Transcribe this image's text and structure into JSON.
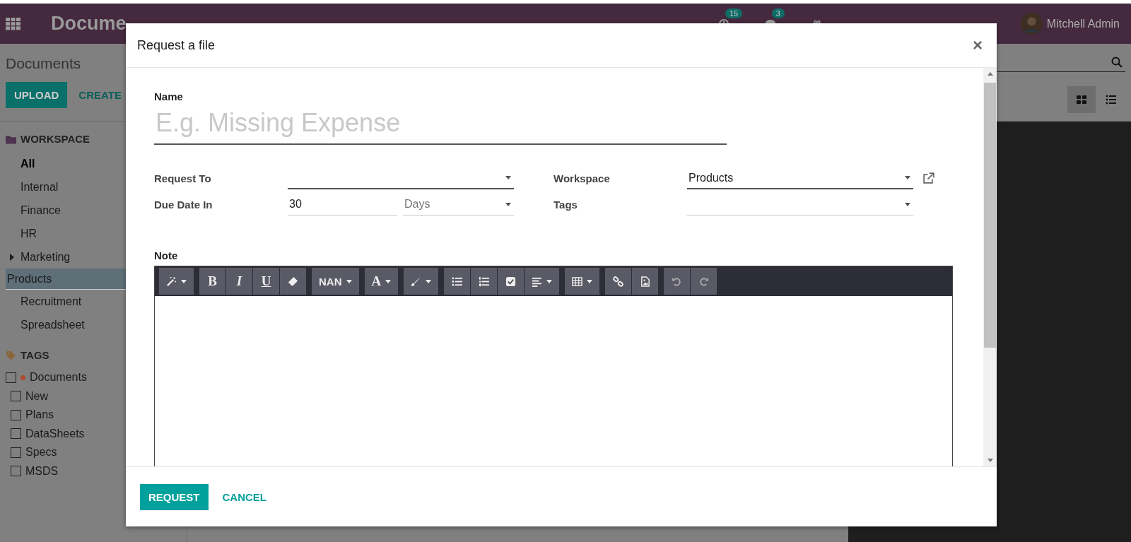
{
  "navbar": {
    "brand": "Docume",
    "systray": [
      {
        "kind": "activity",
        "badge": "15"
      },
      {
        "kind": "chat",
        "badge": "3"
      },
      {
        "kind": "gift"
      }
    ],
    "user": "Mitchell Admin"
  },
  "control_panel": {
    "breadcrumb": "Documents",
    "buttons": [
      "UPLOAD",
      "CREATE"
    ],
    "views": [
      {
        "kind": "kanban",
        "selected": true
      },
      {
        "kind": "list",
        "selected": false
      }
    ]
  },
  "sidebar": {
    "workspace_title": "WORKSPACE",
    "workspaces": [
      {
        "label": "All",
        "active": true,
        "selected": false,
        "expandable": false
      },
      {
        "label": "Internal",
        "active": false,
        "selected": false,
        "expandable": false
      },
      {
        "label": "Finance",
        "active": false,
        "selected": false,
        "expandable": false
      },
      {
        "label": "HR",
        "active": false,
        "selected": false,
        "expandable": false
      },
      {
        "label": "Marketing",
        "active": false,
        "selected": false,
        "expandable": true
      },
      {
        "label": "Products",
        "active": false,
        "selected": true,
        "expandable": false
      },
      {
        "label": "Recruitment",
        "active": false,
        "selected": false,
        "expandable": false
      },
      {
        "label": "Spreadsheet",
        "active": false,
        "selected": false,
        "expandable": false
      }
    ],
    "tags_title": "TAGS",
    "tags": [
      {
        "label": "Documents",
        "checked": false,
        "color": "#b04a30",
        "children": [
          {
            "label": "New",
            "checked": false
          },
          {
            "label": "Plans",
            "checked": false
          },
          {
            "label": "DataSheets",
            "checked": false
          },
          {
            "label": "Specs",
            "checked": false
          },
          {
            "label": "MSDS",
            "checked": false
          }
        ]
      }
    ]
  },
  "dialog": {
    "title": "Request a file",
    "close": "×",
    "name_label": "Name",
    "name_placeholder": "E.g. Missing Expense",
    "fields_left": [
      {
        "label": "Request To",
        "kind": "select",
        "focused": true,
        "link": false
      },
      {
        "label": "Due Date In",
        "kind": "duration",
        "value": "30",
        "unit": "Days",
        "focused": false
      }
    ],
    "fields_right": [
      {
        "label": "Workspace",
        "kind": "select",
        "value": "Products",
        "focused": true,
        "link": true
      },
      {
        "label": "Tags",
        "kind": "select",
        "focused": false,
        "link": false
      }
    ],
    "note_label": "Note",
    "toolbar": [
      [
        {
          "kind": "wand",
          "caret": true
        }
      ],
      [
        {
          "kind": "bold",
          "text": "B"
        },
        {
          "kind": "italic",
          "text": "I"
        },
        {
          "kind": "underline",
          "text": "U"
        },
        {
          "kind": "eraser"
        }
      ],
      [
        {
          "kind": "fontsize",
          "text": "NAN",
          "caret": true
        }
      ],
      [
        {
          "kind": "fontcolor",
          "text": "A",
          "caret": true
        }
      ],
      [
        {
          "kind": "brush",
          "caret": true
        }
      ],
      [
        {
          "kind": "bullets"
        },
        {
          "kind": "numbers"
        },
        {
          "kind": "checkbox"
        },
        {
          "kind": "align",
          "caret": true
        }
      ],
      [
        {
          "kind": "table",
          "caret": true
        }
      ],
      [
        {
          "kind": "link"
        },
        {
          "kind": "image"
        }
      ],
      [
        {
          "kind": "undo"
        },
        {
          "kind": "redo"
        }
      ]
    ],
    "buttons": [
      {
        "label": "REQUEST",
        "kind": "primary"
      },
      {
        "label": "CANCEL",
        "kind": "link"
      }
    ]
  }
}
